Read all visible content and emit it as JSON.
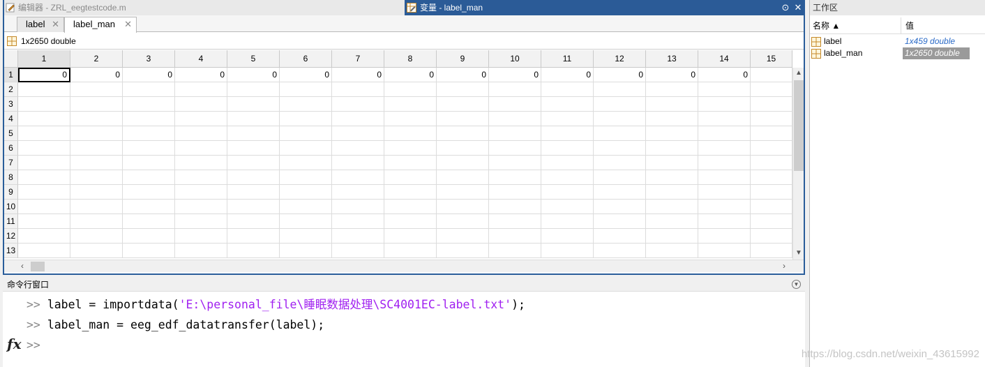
{
  "editor": {
    "title": "编辑器 - ZRL_eegtestcode.m",
    "variables_title": "变量 - label_man",
    "tabs": [
      {
        "label": "label"
      },
      {
        "label": "label_man"
      }
    ],
    "info": "1x2650 double",
    "columns": [
      "1",
      "2",
      "3",
      "4",
      "5",
      "6",
      "7",
      "8",
      "9",
      "10",
      "11",
      "12",
      "13",
      "14",
      "15"
    ],
    "rows": [
      "1",
      "2",
      "3",
      "4",
      "5",
      "6",
      "7",
      "8",
      "9",
      "10",
      "11",
      "12",
      "13"
    ],
    "row1_values": [
      "0",
      "0",
      "0",
      "0",
      "0",
      "0",
      "0",
      "0",
      "0",
      "0",
      "0",
      "0",
      "0",
      "0"
    ]
  },
  "command_window": {
    "title": "命令行窗口",
    "prompt": ">>",
    "line1_code": "label = importdata(",
    "line1_string": "'E:\\personal_file\\睡眠数据处理\\SC4001EC-label.txt'",
    "line1_end": ");",
    "line2_code": "label_man = eeg_edf_datatransfer(label);",
    "fx_label": "fx"
  },
  "workspace": {
    "title": "工作区",
    "col_name": "名称 ▲",
    "col_value": "值",
    "rows": [
      {
        "name": "label",
        "value": "1x459 double"
      },
      {
        "name": "label_man",
        "value": "1x2650 double"
      }
    ]
  },
  "watermark": "https://blog.csdn.net/weixin_43615992",
  "colors": {
    "accent": "#2b5b97",
    "string": "#a020f0"
  }
}
